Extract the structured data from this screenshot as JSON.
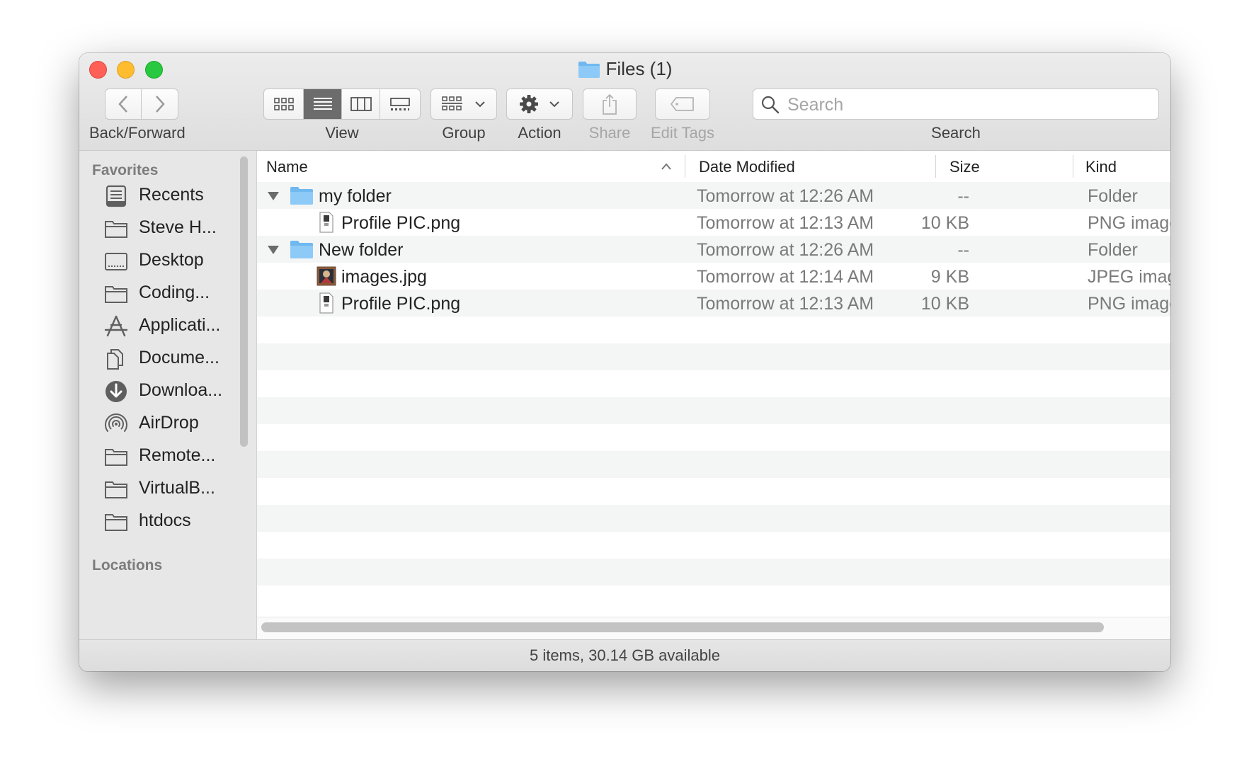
{
  "window": {
    "title": "Files (1)"
  },
  "toolbar": {
    "back_forward_label": "Back/Forward",
    "view_label": "View",
    "group_label": "Group",
    "action_label": "Action",
    "share_label": "Share",
    "edit_tags_label": "Edit Tags",
    "search_label": "Search",
    "search_placeholder": "Search",
    "active_view": "list"
  },
  "sidebar": {
    "favorites_heading": "Favorites",
    "locations_heading": "Locations",
    "items": [
      {
        "label": "Recents",
        "icon": "recents-icon"
      },
      {
        "label": "Steve H...",
        "icon": "folder-icon"
      },
      {
        "label": "Desktop",
        "icon": "desktop-icon"
      },
      {
        "label": "Coding...",
        "icon": "folder-icon"
      },
      {
        "label": "Applicati...",
        "icon": "applications-icon"
      },
      {
        "label": "Docume...",
        "icon": "documents-icon"
      },
      {
        "label": "Downloa...",
        "icon": "downloads-icon"
      },
      {
        "label": "AirDrop",
        "icon": "airdrop-icon"
      },
      {
        "label": "Remote...",
        "icon": "folder-icon"
      },
      {
        "label": "VirtualB...",
        "icon": "folder-icon"
      },
      {
        "label": "htdocs",
        "icon": "folder-icon"
      }
    ]
  },
  "columns": {
    "name": "Name",
    "date": "Date Modified",
    "size": "Size",
    "kind": "Kind"
  },
  "rows": [
    {
      "name": "my folder",
      "date": "Tomorrow at 12:26 AM",
      "size": "--",
      "kind": "Folder"
    },
    {
      "name": "Profile PIC.png",
      "date": "Tomorrow at 12:13 AM",
      "size": "10 KB",
      "kind": "PNG image"
    },
    {
      "name": "New folder",
      "date": "Tomorrow at 12:26 AM",
      "size": "--",
      "kind": "Folder"
    },
    {
      "name": "images.jpg",
      "date": "Tomorrow at 12:14 AM",
      "size": "9 KB",
      "kind": "JPEG image"
    },
    {
      "name": "Profile PIC.png",
      "date": "Tomorrow at 12:13 AM",
      "size": "10 KB",
      "kind": "PNG image"
    }
  ],
  "status": {
    "text": "5 items, 30.14 GB available"
  },
  "colors": {
    "folder": "#7fc3f5",
    "selected_segment": "#6c6c6c",
    "close": "#fe5f57",
    "minimize": "#febc2e",
    "zoom": "#28c840"
  }
}
